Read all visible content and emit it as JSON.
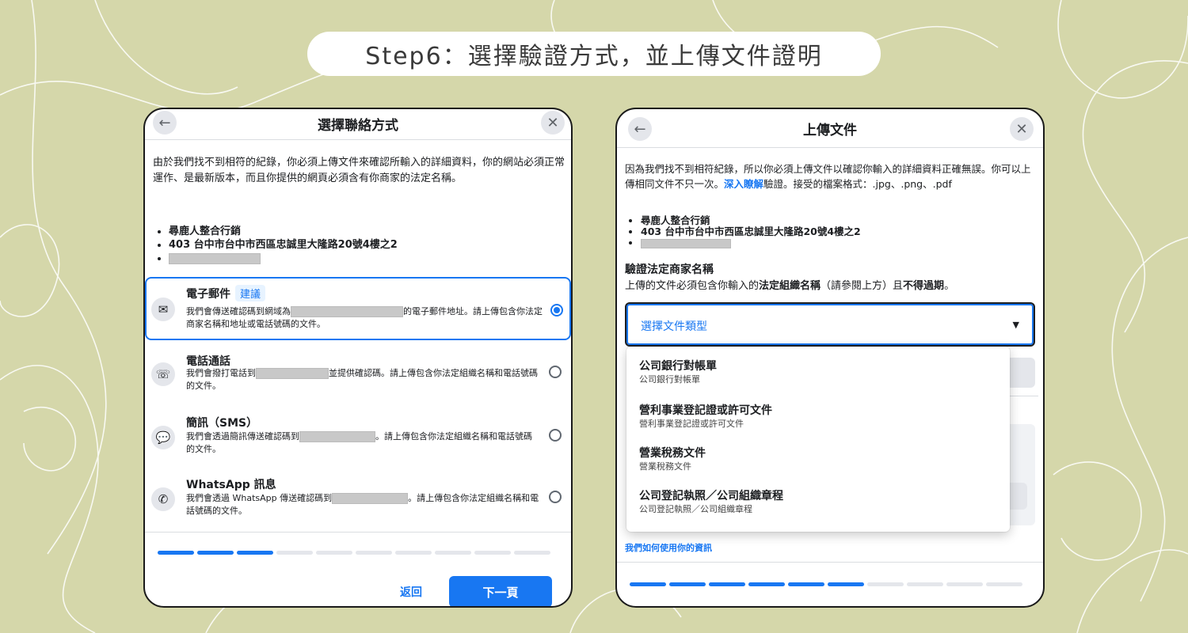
{
  "step_title": "Step6：選擇驗證方式，並上傳文件證明",
  "left_dialog": {
    "title": "選擇聯絡方式",
    "description": "由於我們找不到相符的紀錄，你必須上傳文件來確認所輸入的詳細資料，你的網站必須正常運作、是最新版本，而且你提供的網頁必須含有你商家的法定名稱。",
    "bullets": [
      "尋鹿人整合行銷",
      "403 台中市台中市西區忠誠里大隆路20號4樓之2"
    ],
    "options": [
      {
        "title": "電子郵件",
        "badge": "建議",
        "desc_before": "我們會傳送確認碼到網域為",
        "desc_after": "的電子郵件地址。請上傳包含你法定商家名稱和地址或電話號碼的文件。",
        "icon": "envelope-icon",
        "selected": true
      },
      {
        "title": "電話通話",
        "desc_before": "我們會撥打電話到",
        "desc_after": "並提供確認碼。請上傳包含你法定組織名稱和電話號碼的文件。",
        "icon": "phone-icon",
        "selected": false
      },
      {
        "title": "簡訊（SMS）",
        "desc_before": "我們會透過簡訊傳送確認碼到",
        "desc_after": "。請上傳包含你法定組織名稱和電話號碼的文件。",
        "icon": "chat-bubble-icon",
        "selected": false
      },
      {
        "title": "WhatsApp 訊息",
        "desc_before": "我們會透過 WhatsApp 傳送確認碼到",
        "desc_after": "。請上傳包含你法定組織名稱和電話號碼的文件。",
        "icon": "whatsapp-icon",
        "selected": false
      }
    ],
    "progress": {
      "done": 3,
      "total": 10
    },
    "back_label": "返回",
    "next_label": "下一頁"
  },
  "right_dialog": {
    "title": "上傳文件",
    "description_before": "因為我們找不到相符紀錄，所以你必須上傳文件以確認你輸入的詳細資料正確無誤。你可以上傳相同文件不只一次。",
    "learn_more": "深入瞭解",
    "description_after": "驗證。接受的檔案格式：.jpg、.png、.pdf",
    "bullets": [
      "尋鹿人整合行銷",
      "403 台中市台中市西區忠誠里大隆路20號4樓之2"
    ],
    "section_title": "驗證法定商家名稱",
    "section_desc_1": "上傳的文件必須包含你輸入的",
    "section_desc_bold1": "法定組織名稱",
    "section_desc_2": "（請參閱上方）且",
    "section_desc_bold2": "不得過期",
    "section_desc_3": "。",
    "select_placeholder": "選擇文件類型",
    "dropdown_options": [
      {
        "title": "公司銀行對帳單",
        "sub": "公司銀行對帳單"
      },
      {
        "title": "營利事業登記證或許可文件",
        "sub": "營利事業登記證或許可文件"
      },
      {
        "title": "營業稅務文件",
        "sub": "營業稅務文件"
      },
      {
        "title": "公司登記執照／公司組織章程",
        "sub": "公司登記執照／公司組織章程"
      }
    ],
    "privacy_link": "我們如何使用你的資訊",
    "progress": {
      "done": 6,
      "total": 10
    }
  },
  "colors": {
    "background": "#d5d7aa",
    "accent": "#1877f2"
  }
}
